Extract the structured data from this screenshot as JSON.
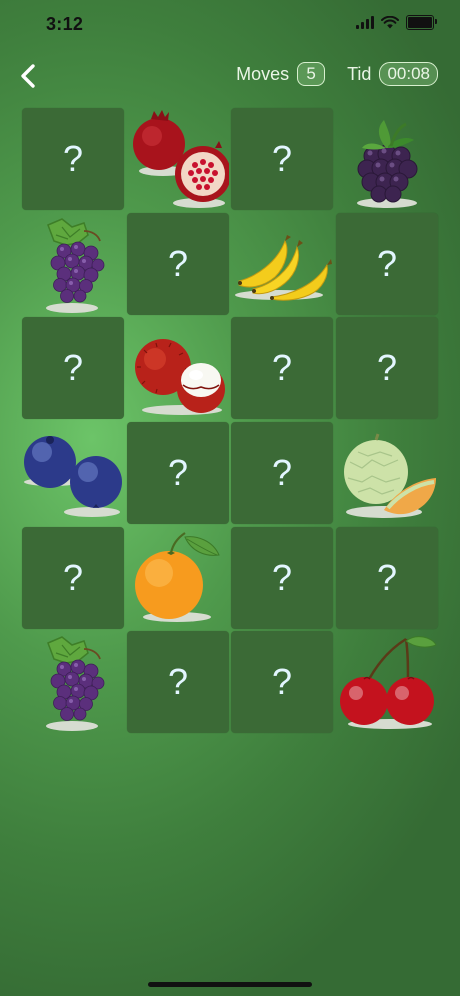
{
  "status_bar": {
    "time": "3:12"
  },
  "header": {
    "moves_label": "Moves",
    "moves_value": "5",
    "time_label": "Tid",
    "time_value": "00:08"
  },
  "board": {
    "columns": 4,
    "rows": 6,
    "hidden_symbol": "?",
    "cards": [
      {
        "state": "hidden",
        "fruit": ""
      },
      {
        "state": "revealed",
        "fruit": "pomegranate"
      },
      {
        "state": "hidden",
        "fruit": ""
      },
      {
        "state": "revealed",
        "fruit": "blackberry"
      },
      {
        "state": "revealed",
        "fruit": "grapes"
      },
      {
        "state": "hidden",
        "fruit": ""
      },
      {
        "state": "revealed",
        "fruit": "banana"
      },
      {
        "state": "hidden",
        "fruit": ""
      },
      {
        "state": "hidden",
        "fruit": ""
      },
      {
        "state": "revealed",
        "fruit": "rambutan"
      },
      {
        "state": "hidden",
        "fruit": ""
      },
      {
        "state": "hidden",
        "fruit": ""
      },
      {
        "state": "revealed",
        "fruit": "blueberry"
      },
      {
        "state": "hidden",
        "fruit": ""
      },
      {
        "state": "hidden",
        "fruit": ""
      },
      {
        "state": "revealed",
        "fruit": "melon"
      },
      {
        "state": "hidden",
        "fruit": ""
      },
      {
        "state": "revealed",
        "fruit": "orange"
      },
      {
        "state": "hidden",
        "fruit": ""
      },
      {
        "state": "hidden",
        "fruit": ""
      },
      {
        "state": "revealed",
        "fruit": "grapes"
      },
      {
        "state": "hidden",
        "fruit": ""
      },
      {
        "state": "hidden",
        "fruit": ""
      },
      {
        "state": "revealed",
        "fruit": "cherry"
      }
    ]
  }
}
